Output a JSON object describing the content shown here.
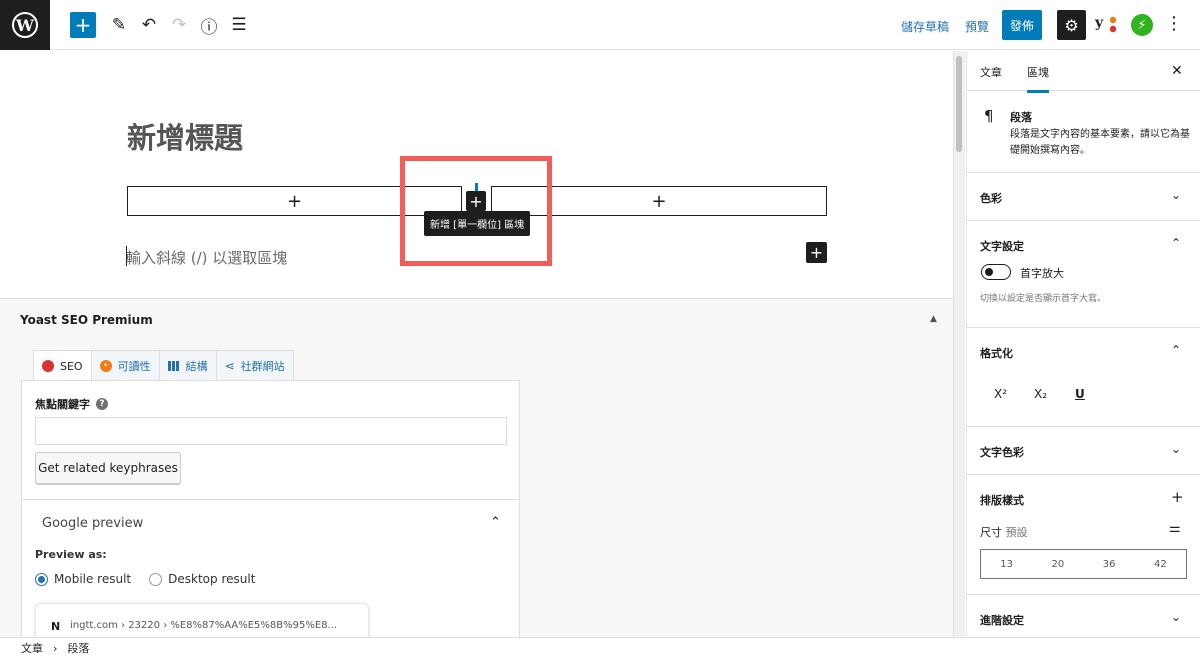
{
  "topbar": {
    "logo": "W",
    "add_icon": "+",
    "edit_icon": "✎",
    "undo_icon": "↶",
    "redo_icon": "↷",
    "info_icon": "ⓘ",
    "list_icon": "☰",
    "save_draft": "儲存草稿",
    "preview": "預覽",
    "publish": "發佈",
    "settings_icon": "⚙",
    "yoast_icon": "y",
    "jetpack_icon": "⚡",
    "more_icon": "⋮"
  },
  "editor": {
    "title_placeholder": "新增標題",
    "col_plus": "+",
    "tooltip": "新增 [單一欄位] 區塊",
    "paragraph_placeholder": "輸入斜線 (/) 以選取區塊",
    "inline_add": "+"
  },
  "yoast": {
    "title": "Yoast SEO Premium",
    "collapse_icon": "▲",
    "tabs": [
      {
        "label": "SEO",
        "icon": "seo-status-icon"
      },
      {
        "label": "可讀性",
        "icon": "readability-icon"
      },
      {
        "label": "結構",
        "icon": "schema-grid-icon"
      },
      {
        "label": "社群網站",
        "icon": "share-icon"
      }
    ],
    "focus_keyphrase_label": "焦點關鍵字",
    "help_icon": "?",
    "keyphrase_value": "",
    "related_button": "Get related keyphrases",
    "google_preview_title": "Google preview",
    "google_preview_chevron": "⌃",
    "preview_as_label": "Preview as:",
    "mobile_result": "Mobile result",
    "desktop_result": "Desktop result",
    "selected_preview": "Mobile result",
    "favicon": "N",
    "serp_url": "ingtt.com › 23220 › %E8%87%AA%E5%8B%95%E8..."
  },
  "sidebar": {
    "tab_post": "文章",
    "tab_block": "區塊",
    "close_icon": "✕",
    "block_icon": "¶",
    "block_name": "段落",
    "block_description": "段落是文字內容的基本要素，請以它為基礎開始撰寫內容。",
    "panels": {
      "color": "色彩",
      "typography": "文字設定",
      "formatting": "格式化",
      "text_color": "文字色彩",
      "styles": "排版樣式",
      "advanced": "進階設定"
    },
    "chevron_down": "⌄",
    "chevron_up": "⌃",
    "plus_icon": "+",
    "drop_cap_label": "首字放大",
    "drop_cap_help": "切換以設定是否顯示首字大寫。",
    "drop_cap_enabled": false,
    "format_sup": "X²",
    "format_sub": "X₂",
    "format_underline": "U",
    "size_label": "尺寸",
    "size_value": "預設",
    "size_ctrl_icon": "⚌",
    "font_sizes": [
      "13",
      "20",
      "36",
      "42"
    ]
  },
  "breadcrumb": {
    "items": [
      "文章",
      "段落"
    ],
    "separator": "›"
  },
  "colors": {
    "accent": "#007cba",
    "highlight": "#f25d57",
    "seo_status": "#dc3232",
    "readability_status": "#ee7c1b",
    "jetpack": "#2fb41f"
  }
}
